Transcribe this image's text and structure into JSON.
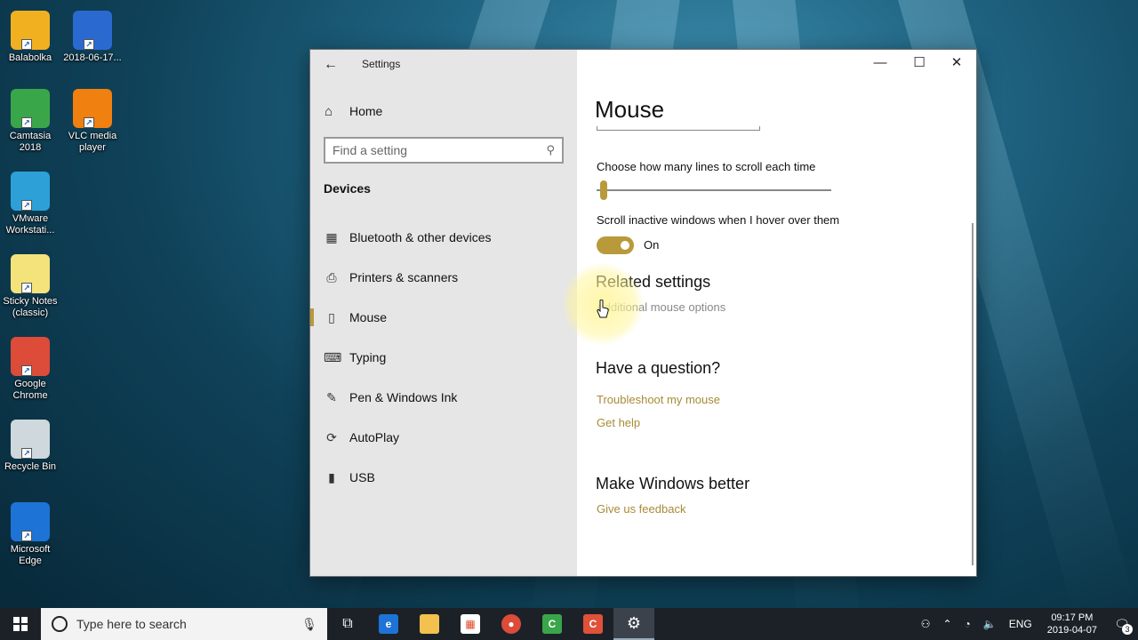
{
  "desktop": {
    "icons": [
      {
        "label": "Balabolka",
        "icon": "balabolka-icon",
        "color": "#f0b020"
      },
      {
        "label": "2018-06-17...",
        "icon": "video-file-icon",
        "color": "#2a6ad0"
      },
      {
        "label": "Camtasia\n2018",
        "icon": "camtasia-icon",
        "color": "#3aa64a"
      },
      {
        "label": "VLC media\nplayer",
        "icon": "vlc-icon",
        "color": "#f08010"
      },
      {
        "label": "VMware\nWorkstati...",
        "icon": "vmware-icon",
        "color": "#2da0d8"
      },
      {
        "label": "Sticky Notes\n(classic)",
        "icon": "sticky-notes-icon",
        "color": "#f4e37a"
      },
      {
        "label": "Google\nChrome",
        "icon": "chrome-icon",
        "color": "#dd4b39"
      },
      {
        "label": "Recycle Bin",
        "icon": "recycle-bin-icon",
        "color": "#cfd8dc"
      },
      {
        "label": "Microsoft\nEdge",
        "icon": "edge-icon",
        "color": "#1e73d6"
      }
    ]
  },
  "window": {
    "title": "Settings",
    "accent": "#b89a3b",
    "sidebar": {
      "home_label": "Home",
      "search_placeholder": "Find a setting",
      "section": "Devices",
      "items": [
        {
          "label": "Bluetooth & other devices",
          "icon": "bluetooth-devices-icon",
          "glyph": "▦"
        },
        {
          "label": "Printers & scanners",
          "icon": "printer-icon",
          "glyph": "⎙"
        },
        {
          "label": "Mouse",
          "icon": "mouse-icon",
          "glyph": "▯",
          "active": true
        },
        {
          "label": "Typing",
          "icon": "keyboard-icon",
          "glyph": "⌨"
        },
        {
          "label": "Pen & Windows Ink",
          "icon": "pen-icon",
          "glyph": "✎"
        },
        {
          "label": "AutoPlay",
          "icon": "autoplay-icon",
          "glyph": "⟳"
        },
        {
          "label": "USB",
          "icon": "usb-icon",
          "glyph": "▮"
        }
      ]
    },
    "main": {
      "title": "Mouse",
      "scroll_lines_label": "Choose how many lines to scroll each time",
      "scroll_lines_value": 1,
      "inactive_label": "Scroll inactive windows when I hover over them",
      "inactive_state": "On",
      "related_heading": "Related settings",
      "related_link": "Additional mouse options",
      "question_heading": "Have a question?",
      "troubleshoot_link": "Troubleshoot my mouse",
      "help_link": "Get help",
      "better_heading": "Make Windows better",
      "feedback_link": "Give us feedback"
    }
  },
  "taskbar": {
    "search_placeholder": "Type here to search",
    "language": "ENG",
    "time": "09:17 PM",
    "date": "2019-04-07",
    "notifications": "3"
  }
}
